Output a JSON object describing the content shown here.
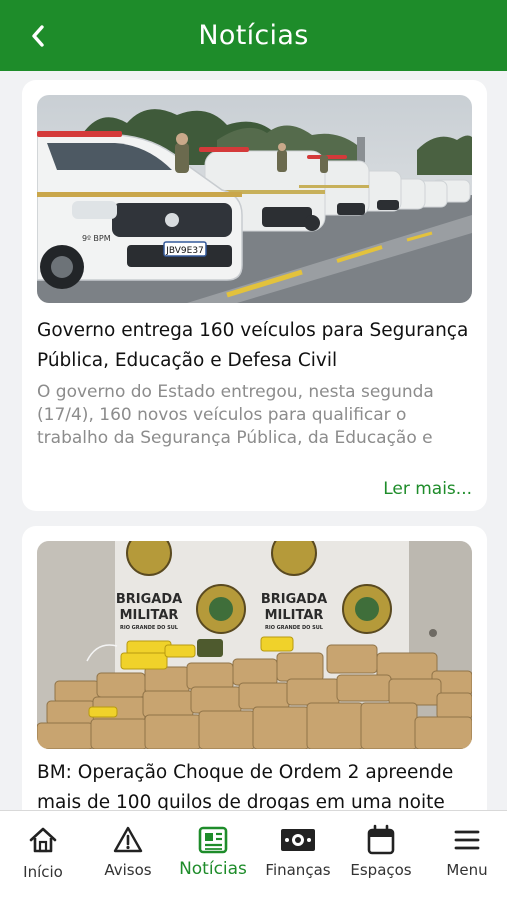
{
  "header": {
    "title": "Notícias"
  },
  "colors": {
    "brand": "#1e8c2a",
    "text": "#111111",
    "muted": "#8c8c8c",
    "background": "#f1f2f4"
  },
  "articles": [
    {
      "title": "Governo entrega 160 veículos para Segurança Pública, Educação e Defesa Civil",
      "summary": "O governo do Estado entregou, nesta segunda (17/4), 160 novos veículos para qualificar o trabalho da Segurança Pública, da Educação e",
      "read_more": "Ler mais...",
      "image_icon": "police-vehicles-photo",
      "plate": "JBV9E37",
      "unit": "9º BPM"
    },
    {
      "title": "BM: Operação Choque de Ordem 2 apreende mais de 100 quilos de drogas em uma noite",
      "image_icon": "seized-drugs-photo",
      "banner_line1": "BRIGADA",
      "banner_line2": "MILITAR",
      "banner_sub": "RIO GRANDE DO SUL"
    }
  ],
  "tabs": [
    {
      "label": "Início",
      "icon": "home-icon"
    },
    {
      "label": "Avisos",
      "icon": "warning-icon"
    },
    {
      "label": "Notícias",
      "icon": "news-icon",
      "active": true
    },
    {
      "label": "Finanças",
      "icon": "money-icon"
    },
    {
      "label": "Espaços",
      "icon": "calendar-icon"
    },
    {
      "label": "Menu",
      "icon": "menu-icon"
    }
  ]
}
